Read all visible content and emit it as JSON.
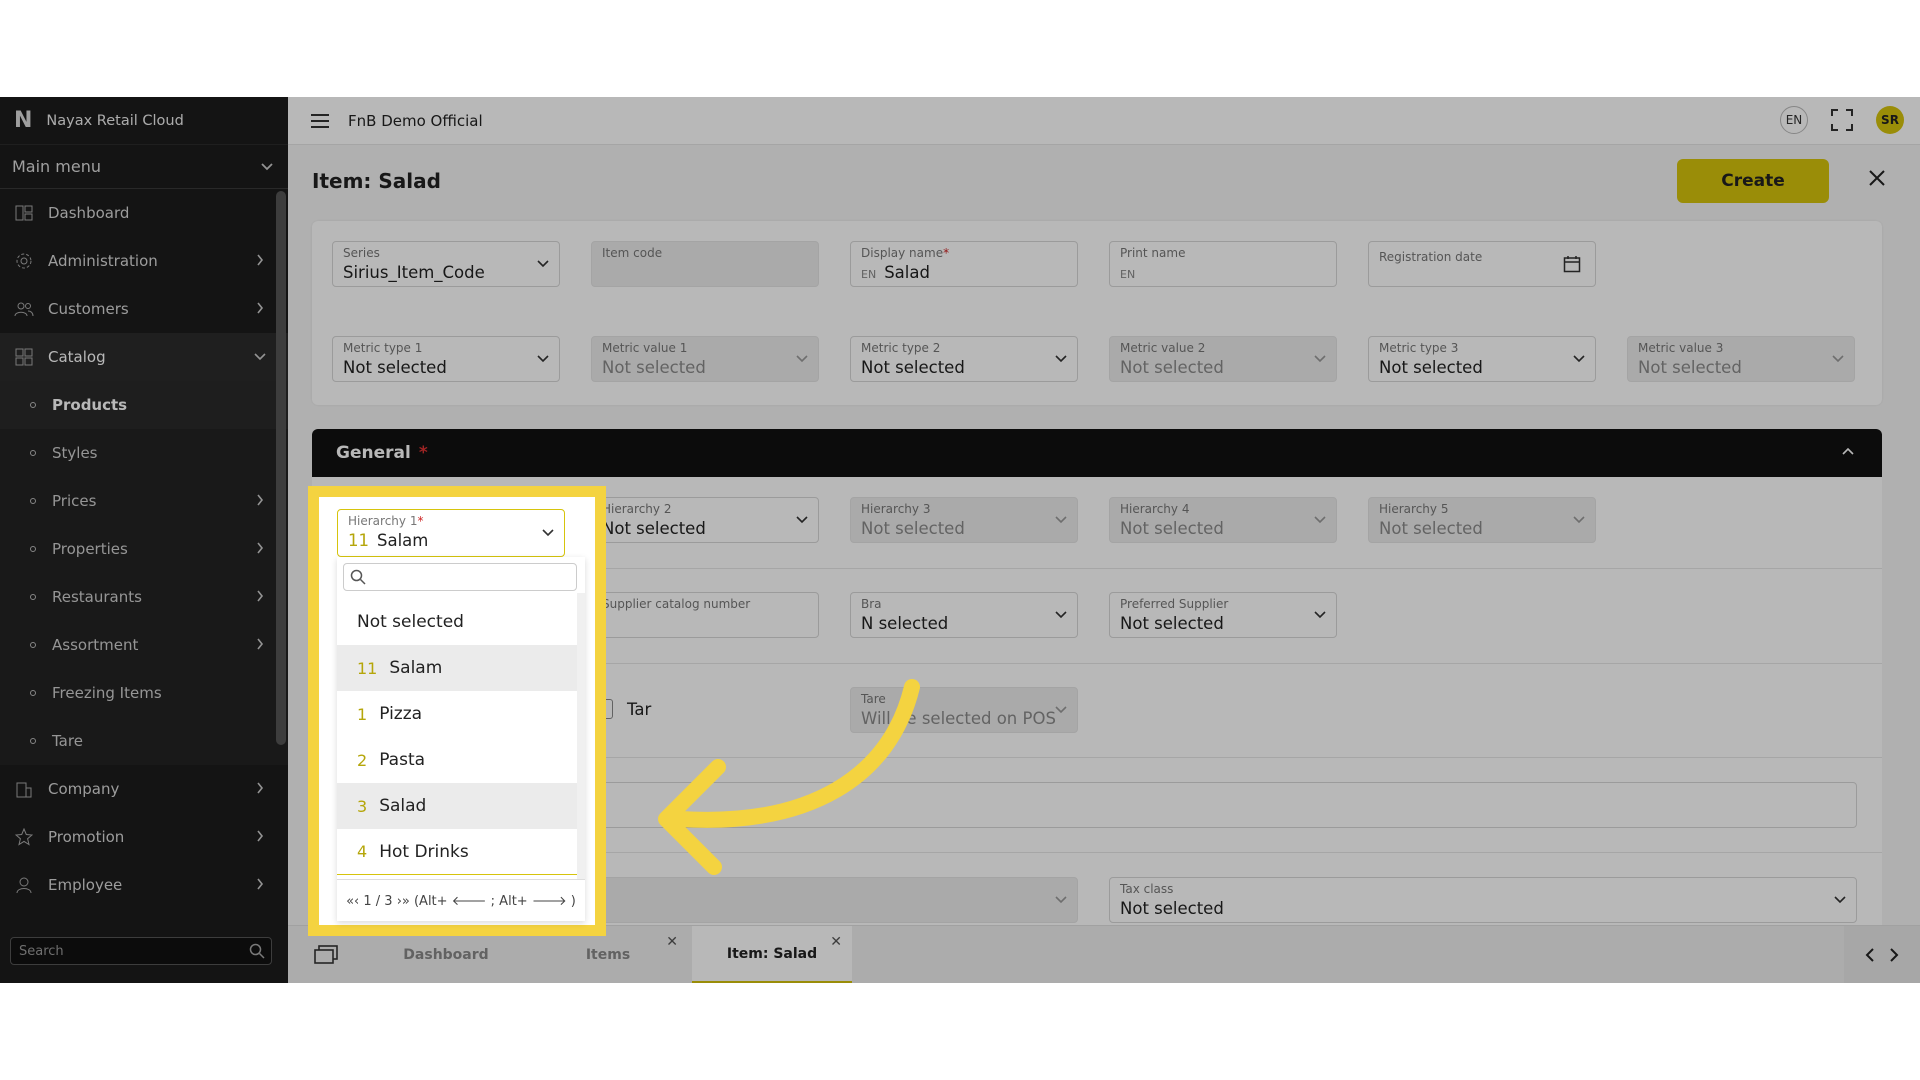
{
  "app": {
    "name": "Nayax Retail Cloud",
    "logo": "N"
  },
  "sidebar": {
    "main_menu": "Main menu",
    "items": [
      {
        "label": "Dashboard",
        "icon": "dashboard-icon"
      },
      {
        "label": "Administration",
        "icon": "gear-icon"
      },
      {
        "label": "Customers",
        "icon": "users-icon"
      },
      {
        "label": "Catalog",
        "icon": "grid-icon"
      }
    ],
    "catalog_sub": [
      {
        "label": "Products"
      },
      {
        "label": "Styles"
      },
      {
        "label": "Prices"
      },
      {
        "label": "Properties"
      },
      {
        "label": "Restaurants"
      },
      {
        "label": "Assortment"
      },
      {
        "label": "Freezing Items"
      },
      {
        "label": "Tare"
      }
    ],
    "items_bottom": [
      {
        "label": "Company",
        "icon": "building-icon"
      },
      {
        "label": "Promotion",
        "icon": "star-icon"
      },
      {
        "label": "Employee",
        "icon": "person-icon"
      }
    ],
    "search_placeholder": "Search"
  },
  "topbar": {
    "company": "FnB Demo Official",
    "lang": "EN",
    "user": "SR"
  },
  "page": {
    "title": "Item: Salad",
    "create_label": "Create"
  },
  "header_fields": {
    "series": {
      "label": "Series",
      "value": "Sirius_Item_Code"
    },
    "item_code": {
      "label": "Item code"
    },
    "display_name": {
      "label": "Display name",
      "lang": "EN",
      "value": "Salad"
    },
    "print_name": {
      "label": "Print name",
      "lang": "EN"
    },
    "registration_date": {
      "label": "Registration date"
    },
    "metric_type_1": {
      "label": "Metric type 1",
      "value": "Not selected"
    },
    "metric_value_1": {
      "label": "Metric value 1",
      "value": "Not selected"
    },
    "metric_type_2": {
      "label": "Metric type 2",
      "value": "Not selected"
    },
    "metric_value_2": {
      "label": "Metric value 2",
      "value": "Not selected"
    },
    "metric_type_3": {
      "label": "Metric type 3",
      "value": "Not selected"
    },
    "metric_value_3": {
      "label": "Metric value 3",
      "value": "Not selected"
    }
  },
  "general": {
    "title": "General",
    "required_mark": "*",
    "hierarchy_1": {
      "label": "Hierarchy 1",
      "num": "11",
      "value": "Salam"
    },
    "hierarchy_2": {
      "label": "Hierarchy 2",
      "value": "Not selected"
    },
    "hierarchy_3": {
      "label": "Hierarchy 3",
      "value": "Not selected"
    },
    "hierarchy_4": {
      "label": "Hierarchy 4",
      "value": "Not selected"
    },
    "hierarchy_5": {
      "label": "Hierarchy 5",
      "value": "Not selected"
    },
    "supplier_catalog": {
      "label": "Supplier catalog number"
    },
    "brand": {
      "label": "Bra",
      "value": "N   selected"
    },
    "preferred_supplier": {
      "label": "Preferred Supplier",
      "value": "Not selected"
    },
    "tare_checkbox": "Tar",
    "tare": {
      "label": "Tare",
      "value": "Will be selected on POS"
    },
    "tax_class": {
      "label": "Tax class",
      "value": "Not selected"
    }
  },
  "dropdown": {
    "options": [
      {
        "num": "",
        "label": "Not selected"
      },
      {
        "num": "11",
        "label": "Salam"
      },
      {
        "num": "1",
        "label": "Pizza"
      },
      {
        "num": "2",
        "label": "Pasta"
      },
      {
        "num": "3",
        "label": "Salad"
      },
      {
        "num": "4",
        "label": "Hot Drinks"
      }
    ],
    "pager": "«‹  1 / 3  ›»  (Alt+ 🡐 ; Alt+ 🡒 )"
  },
  "tabs": [
    {
      "label": "Dashboard"
    },
    {
      "label": "Items"
    },
    {
      "label": "Item: Salad"
    }
  ],
  "colors": {
    "accent": "#d6c40c",
    "highlight": "#f4d340",
    "sidebar": "#1c1c1c"
  }
}
